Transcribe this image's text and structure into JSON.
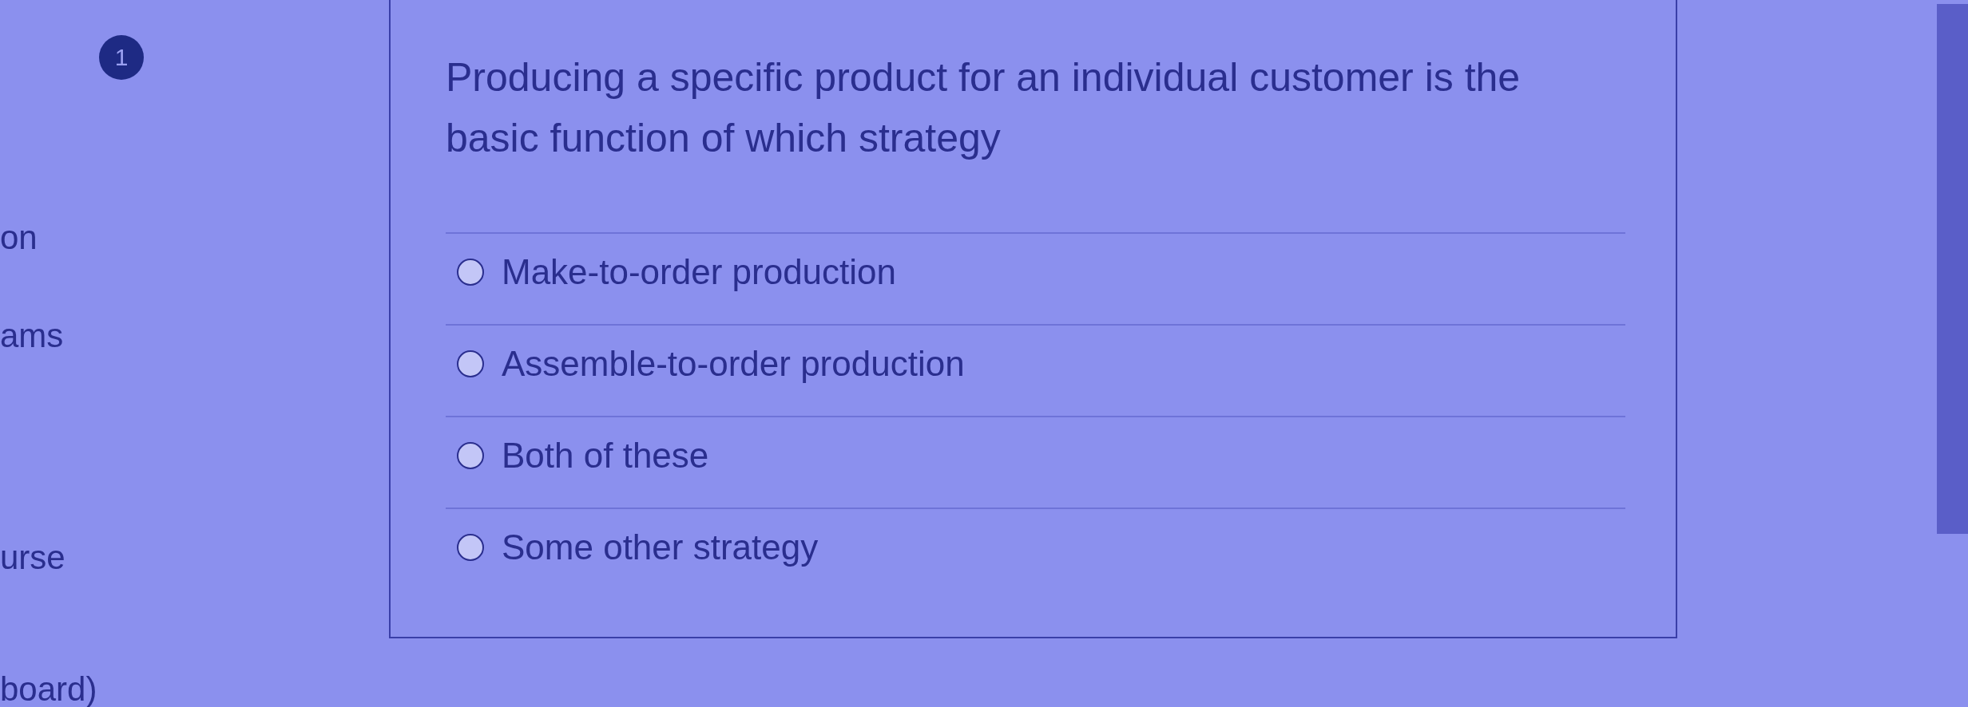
{
  "question": {
    "number": "1",
    "text": "Producing a specific product for an individual customer is the basic function of which strategy",
    "options": [
      {
        "label": "Make-to-order production",
        "selected": false
      },
      {
        "label": "Assemble-to-order production",
        "selected": false
      },
      {
        "label": "Both of these",
        "selected": false
      },
      {
        "label": "Some other strategy",
        "selected": false
      }
    ]
  },
  "sidebar": {
    "items": [
      {
        "label": "on"
      },
      {
        "label": "ams"
      },
      {
        "label": "urse"
      },
      {
        "label": "board)"
      }
    ]
  }
}
